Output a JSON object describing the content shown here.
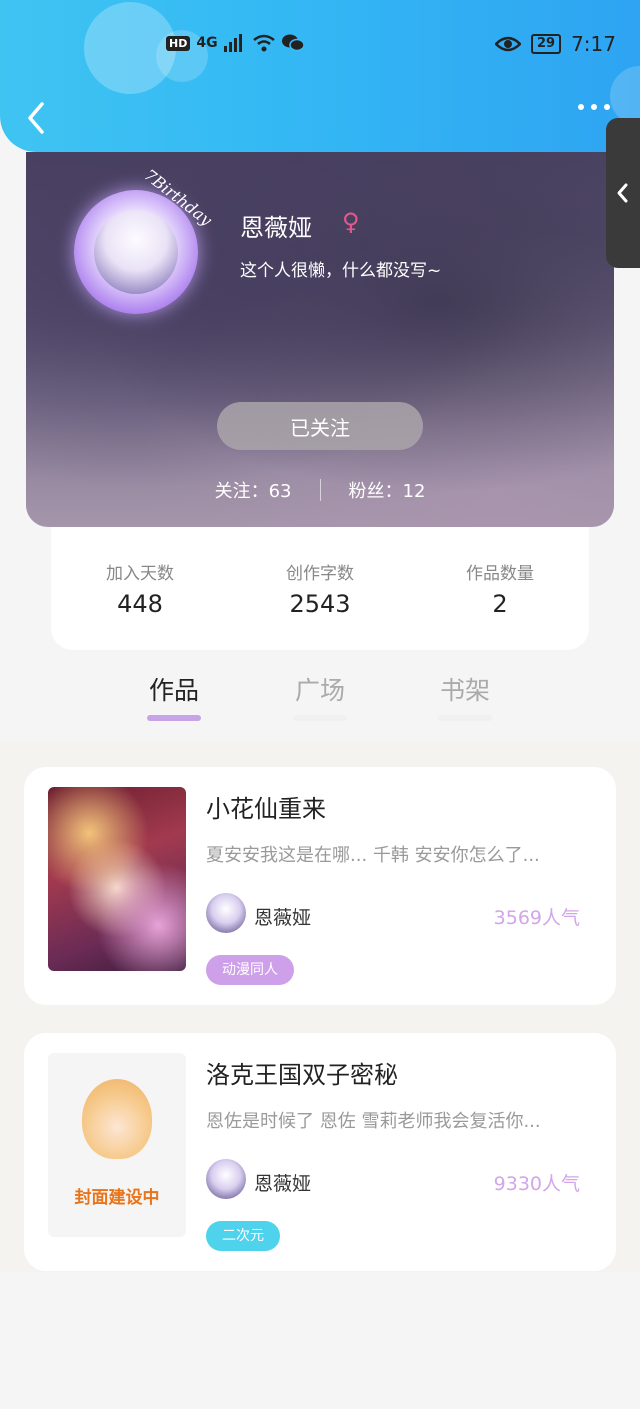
{
  "status_bar": {
    "hd": "HD",
    "network": "4G",
    "battery": "29",
    "time": "7:17"
  },
  "profile": {
    "avatar_badge": "7Birthday",
    "username": "恩薇娅",
    "gender_symbol": "♀",
    "bio": "这个人很懒，什么都没写~",
    "follow_button": "已关注",
    "following": "关注：63",
    "fans": "粉丝：12"
  },
  "stats": [
    {
      "label": "加入天数",
      "value": "448"
    },
    {
      "label": "创作字数",
      "value": "2543"
    },
    {
      "label": "作品数量",
      "value": "2"
    }
  ],
  "tabs": [
    {
      "label": "作品",
      "active": true
    },
    {
      "label": "广场",
      "active": false
    },
    {
      "label": "书架",
      "active": false
    }
  ],
  "works": [
    {
      "title": "小花仙重来",
      "excerpt": "夏安安我这是在哪... 千韩 安安你怎么了...",
      "author": "恩薇娅",
      "popularity": "3569人气",
      "tag": "动漫同人",
      "tag_color": "#cfa0ea"
    },
    {
      "title": "洛克王国双子密秘",
      "excerpt": "恩佐是时候了 恩佐 雪莉老师我会复活你...",
      "author": "恩薇娅",
      "popularity": "9330人气",
      "tag": "二次元",
      "tag_color": "#4fd3ec",
      "cover_text": "封面建设中"
    }
  ],
  "colors": {
    "header_start": "#3fc4f2",
    "header_end": "#2ea4f2",
    "tab_underline": "#c6a4e6",
    "popularity": "#d2a6e8"
  }
}
